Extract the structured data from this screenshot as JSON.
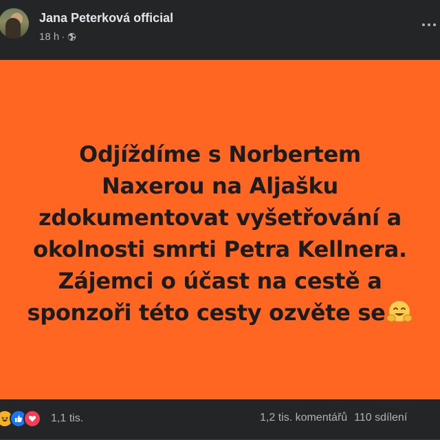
{
  "post": {
    "author": "Jana Peterková official",
    "time": "18 h",
    "separator": "·",
    "privacy_icon": "globe-icon",
    "more_icon": "more-horizontal-icon"
  },
  "image": {
    "background_color": "#ff6622",
    "text_color": "#1c1c1c",
    "lines": [
      "Odjíždíme s Norbertem",
      "Naxerou na Aljašku",
      "zdokumentovat vyšetřování a",
      "okolnosti smrti Petra Kellnera.",
      "Zájemci o účast na cestě a",
      "sponzoři této cesty ozvěte se"
    ],
    "trailing_emoji": "hugging-face-emoji"
  },
  "footer": {
    "reactions": [
      "haha",
      "like",
      "love"
    ],
    "reaction_count": "1,1 tis.",
    "comments": "1,2 tis. komentářů",
    "shares": "110 sdílení"
  }
}
